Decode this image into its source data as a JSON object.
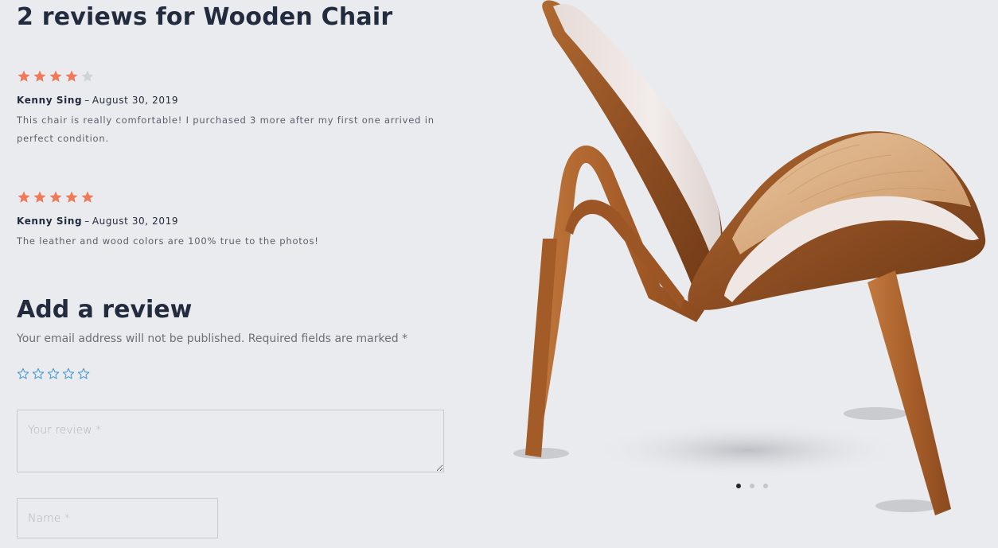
{
  "reviews_section": {
    "title": "2 reviews for Wooden Chair",
    "reviews": [
      {
        "rating": 4,
        "max_rating": 5,
        "author": "Kenny Sing",
        "separator": "–",
        "date": "August 30, 2019",
        "text": "This chair is really comfortable! I purchased 3 more after my first one arrived in perfect condition."
      },
      {
        "rating": 5,
        "max_rating": 5,
        "author": "Kenny Sing",
        "separator": "–",
        "date": "August 30, 2019",
        "text": "The leather and wood colors are 100% true to the photos!"
      }
    ]
  },
  "add_review": {
    "title": "Add a review",
    "notice": "Your email address will not be published. Required fields are marked *",
    "rating_input_count": 5,
    "review_placeholder": "Your review *",
    "name_placeholder": "Name *"
  },
  "gallery": {
    "image_name": "wooden-chair",
    "slide_count": 3,
    "active_slide": 1
  },
  "colors": {
    "background": "#eaebee",
    "heading": "#232b3e",
    "star_filled": "#ee7a5a",
    "star_empty": "#d2d3d8",
    "rating_input_star": "#4a9bd6",
    "dot_active": "#222632",
    "dot_inactive": "#c5c6cb"
  }
}
